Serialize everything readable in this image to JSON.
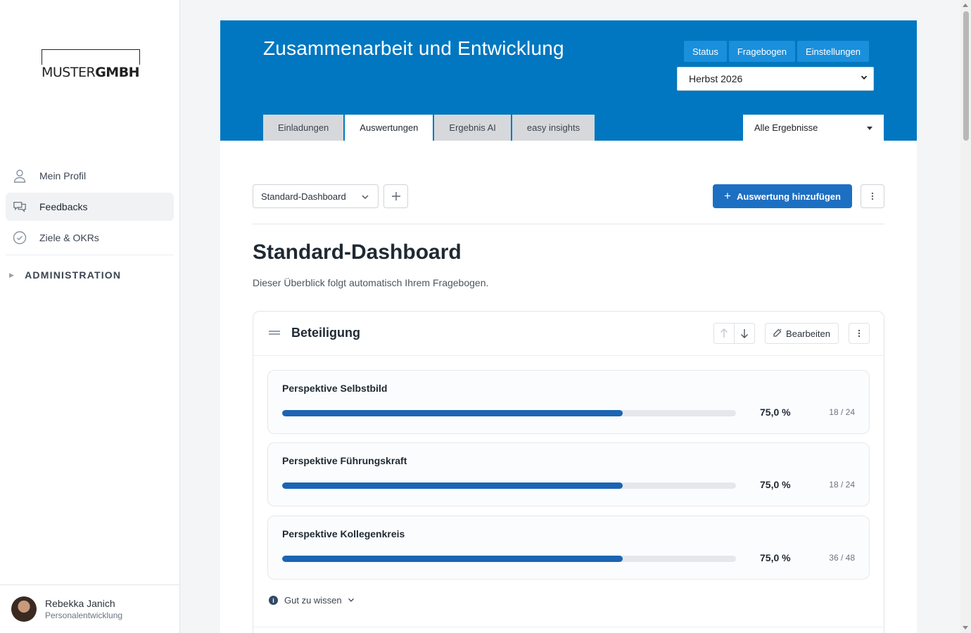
{
  "sidebar": {
    "logo": {
      "part1": "MUSTER",
      "part2": "GMBH"
    },
    "items": [
      {
        "label": "Mein Profil",
        "icon": "user-icon"
      },
      {
        "label": "Feedbacks",
        "icon": "chat-icon"
      },
      {
        "label": "Ziele & OKRs",
        "icon": "check-circle-icon"
      }
    ],
    "admin_label": "ADMINISTRATION",
    "user": {
      "name": "Rebekka Janich",
      "role": "Personalentwicklung"
    }
  },
  "header": {
    "title": "Zusammenarbeit und Entwicklung",
    "buttons": [
      "Status",
      "Fragebogen",
      "Einstellungen"
    ],
    "period": "Herbst 2026",
    "tabs": [
      "Einladungen",
      "Auswertungen",
      "Ergebnis AI",
      "easy insights"
    ],
    "active_tab": "Auswertungen",
    "filter": "Alle Ergebnisse"
  },
  "toolbar": {
    "dashboard_select": "Standard-Dashboard",
    "add_label": "Auswertung hinzufügen"
  },
  "dashboard": {
    "title": "Standard-Dashboard",
    "subtitle": "Dieser Überblick folgt automatisch Ihrem Fragebogen."
  },
  "card": {
    "title": "Beteiligung",
    "edit_label": "Bearbeiten",
    "perspectives": [
      {
        "title": "Perspektive Selbstbild",
        "percent_label": "75,0 %",
        "fraction": 0.75,
        "count": "18 / 24"
      },
      {
        "title": "Perspektive Führungskraft",
        "percent_label": "75,0 %",
        "fraction": 0.75,
        "count": "18 / 24"
      },
      {
        "title": "Perspektive Kollegenkreis",
        "percent_label": "75,0 %",
        "fraction": 0.75,
        "count": "36 / 48"
      }
    ],
    "info_label": "Gut zu wissen"
  },
  "colors": {
    "brand": "#0077c0",
    "accent": "#1d6fc2",
    "bar": "#1b64b4"
  }
}
